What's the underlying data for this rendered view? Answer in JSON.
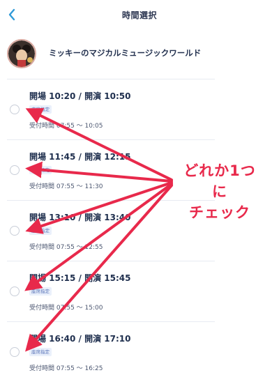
{
  "header": {
    "title": "時間選択",
    "back_icon": "chevron-left-icon"
  },
  "show": {
    "title": "ミッキーのマジカルミュージックワールド"
  },
  "slots": [
    {
      "time": "開場 10:20 / 開演 10:50",
      "badge": "座席指定",
      "reception": "受付時間 07:55 ～ 10:05"
    },
    {
      "time": "開場 11:45 / 開演 12:15",
      "badge": "座席指定",
      "reception": "受付時間 07:55 ～ 11:30"
    },
    {
      "time": "開場 13:10 / 開演 13:40",
      "badge": "座席指定",
      "reception": "受付時間 07:55 ～ 12:55"
    },
    {
      "time": "開場 15:15 / 開演 15:45",
      "badge": "座席指定",
      "reception": "受付時間 07:55 ～ 15:00"
    },
    {
      "time": "開場 16:40 / 開演 17:10",
      "badge": "座席指定",
      "reception": "受付時間 07:55 ～ 16:25"
    }
  ],
  "annotation": {
    "line1": "どれか1つに",
    "line2": "チェック",
    "color": "#e8294b"
  },
  "colors": {
    "accent": "#2f9ad8",
    "text": "#1f2f4e",
    "badge_bg": "#eaf0fb"
  }
}
